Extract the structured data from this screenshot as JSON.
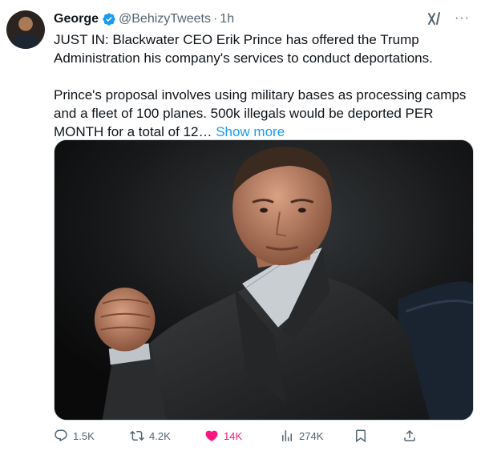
{
  "author": {
    "name": "George",
    "handle": "@BehizyTweets",
    "separator": "·",
    "time": "1h",
    "verified": true
  },
  "tweet": {
    "paragraph1": "JUST IN: Blackwater CEO Erik Prince has offered the Trump Administration his company's services to conduct deportations.",
    "paragraph2": "Prince's proposal involves using military bases as processing camps and a fleet of 100 planes. 500k illegals would be deported PER MONTH for a total of 12…",
    "show_more": "Show more"
  },
  "actions": {
    "replies": "1.5K",
    "reposts": "4.2K",
    "likes": "14K",
    "views": "274K"
  },
  "icons": {
    "verified": "verified-badge-icon",
    "grok": "grok-icon",
    "more": "more-icon",
    "reply": "reply-icon",
    "repost": "repost-icon",
    "like": "heart-icon",
    "views": "views-icon",
    "bookmark": "bookmark-icon",
    "share": "share-icon"
  },
  "colors": {
    "accent": "#1d9bf0",
    "like": "#f91880",
    "muted": "#536471"
  }
}
